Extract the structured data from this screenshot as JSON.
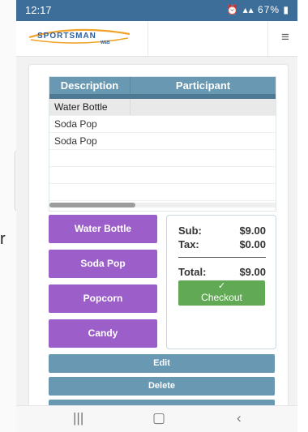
{
  "background": {
    "stray_char": "r"
  },
  "statusbar": {
    "time": "12:17",
    "battery": "67%"
  },
  "appbar": {
    "logo_text": "SPORTSMAN",
    "logo_subtext": "WEB"
  },
  "table": {
    "headers": [
      "Description",
      "Participant"
    ],
    "rows": [
      "Water Bottle",
      "Soda Pop",
      "Soda Pop"
    ],
    "selected_row": "Water Bottle"
  },
  "products": [
    "Water Bottle",
    "Soda Pop",
    "Popcorn",
    "Candy"
  ],
  "summary": {
    "sub_label": "Sub:",
    "sub_value": "$9.00",
    "tax_label": "Tax:",
    "tax_value": "$0.00",
    "total_label": "Total:",
    "total_value": "$9.00",
    "checkout_label": "Checkout"
  },
  "actions": {
    "edit": "Edit",
    "delete": "Delete"
  },
  "colors": {
    "statusbar": "#3d6e99",
    "header": "#6998b2",
    "product_button": "#9c5fc9",
    "checkout": "#62a955"
  },
  "icons": {
    "menu": "hamburger-icon",
    "checkout": "check-icon",
    "nav_recents": "recents-icon",
    "nav_home": "home-icon",
    "nav_back": "back-icon"
  }
}
